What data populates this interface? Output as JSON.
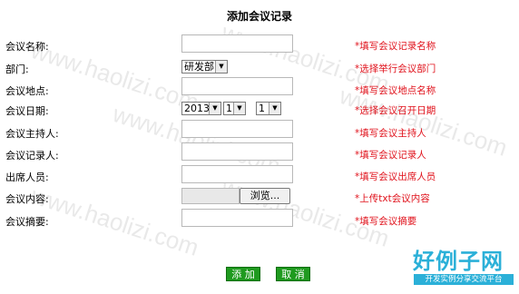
{
  "title": "添加会议记录",
  "fields": {
    "name": {
      "label": "会议名称:",
      "hint": "*填写会议记录名称"
    },
    "dept": {
      "label": "部门:",
      "hint": "*选择举行会议部门",
      "selected": "研发部"
    },
    "place": {
      "label": "会议地点:",
      "hint": "*填写会议地点名称"
    },
    "date": {
      "label": "会议日期:",
      "hint": "*选择会议召开日期",
      "year": "2013",
      "month": "1",
      "day": "1"
    },
    "host": {
      "label": "会议主持人:",
      "hint": "*填写会议主持人"
    },
    "recorder": {
      "label": "会议记录人:",
      "hint": "*填写会议记录人"
    },
    "attendees": {
      "label": "出席人员:",
      "hint": "*填写会议出席人员"
    },
    "content": {
      "label": "会议内容:",
      "hint": "*上传txt会议内容",
      "browse": "浏览..."
    },
    "summary": {
      "label": "会议摘要:",
      "hint": "*填写会议摘要"
    }
  },
  "buttons": {
    "add": "添 加",
    "cancel": "取 消"
  },
  "watermark": {
    "text": "www.haolizi.com",
    "logo": "好例子网",
    "slogan": "开发实例分享交流平台"
  },
  "colors": {
    "hint": "#e0101a",
    "button": "#1f9a1f",
    "logo": "#2bb0d8"
  }
}
